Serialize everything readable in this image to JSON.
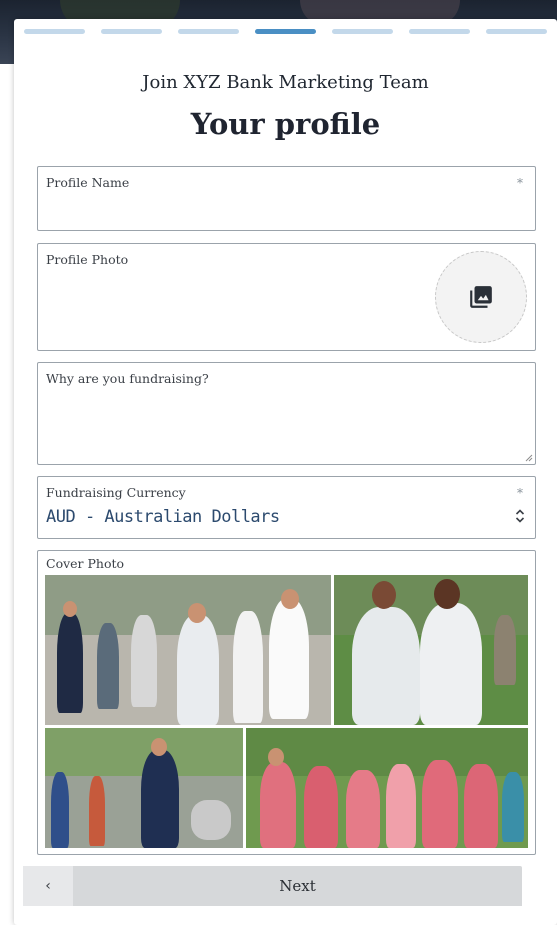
{
  "header": {
    "subtitle": "Join XYZ Bank Marketing Team",
    "title": "Your profile"
  },
  "progress": {
    "total_steps": 7,
    "current_step": 4
  },
  "form": {
    "profile_name": {
      "label": "Profile Name",
      "required_marker": "*",
      "value": ""
    },
    "profile_photo": {
      "label": "Profile Photo",
      "icon": "image-upload-icon"
    },
    "why_fundraising": {
      "label": "Why are you fundraising?",
      "value": ""
    },
    "currency": {
      "label": "Fundraising Currency",
      "required_marker": "*",
      "selected": "AUD - Australian Dollars",
      "icon": "select-chevrons-icon"
    },
    "cover_photo": {
      "label": "Cover Photo"
    }
  },
  "footer": {
    "back_label": "‹",
    "next_label": "Next"
  },
  "colors": {
    "step_active": "#4a8fc4",
    "step_inactive": "#c3d8ea",
    "select_text": "#2c4a6e"
  }
}
